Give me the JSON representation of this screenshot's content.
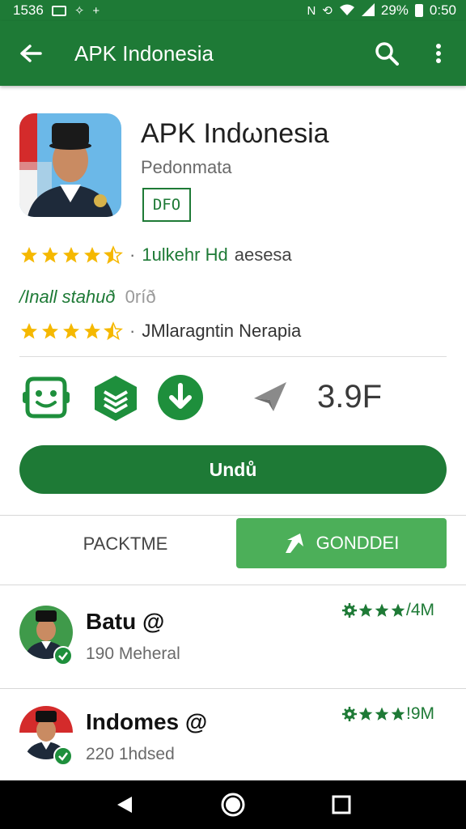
{
  "status_bar": {
    "time_left": "1536",
    "battery_percent": "29%",
    "clock": "0:50"
  },
  "app_bar": {
    "title": "APK Indonesia",
    "icons": [
      "back-arrow-icon",
      "search-icon",
      "more-vert-icon"
    ]
  },
  "app": {
    "name": "APK Indωnesia",
    "developer": "Pedonmata",
    "rating_badge": "DFO"
  },
  "info": {
    "rating_row_1": {
      "stars": 4.5,
      "text": "1ulkehr Hd",
      "text_suffix": "aesesa"
    },
    "install": {
      "label": "/Inall stahuð",
      "value": "0ríð"
    },
    "rating_row_2": {
      "stars": 4.5,
      "text": "JMlaragntin Nerapia"
    }
  },
  "features": {
    "icons": [
      "robot-face-icon",
      "layers-icon",
      "download-circle-icon",
      "navigation-arrow-icon"
    ],
    "score": "3.9F"
  },
  "download_button": {
    "label": "Undů"
  },
  "tabs": {
    "left": "PACKTME",
    "right": "GONDDEI"
  },
  "list": [
    {
      "title": "Batu @",
      "subtitle": "190 Meheral",
      "right_text": "/4M",
      "stars": 3
    },
    {
      "title": "Indomes @",
      "subtitle": "220 1hdsed",
      "right_text": "!9M",
      "stars": 3
    }
  ],
  "colors": {
    "primary": "#1e7a36",
    "accent": "#4caf59",
    "star": "#f5b800"
  }
}
